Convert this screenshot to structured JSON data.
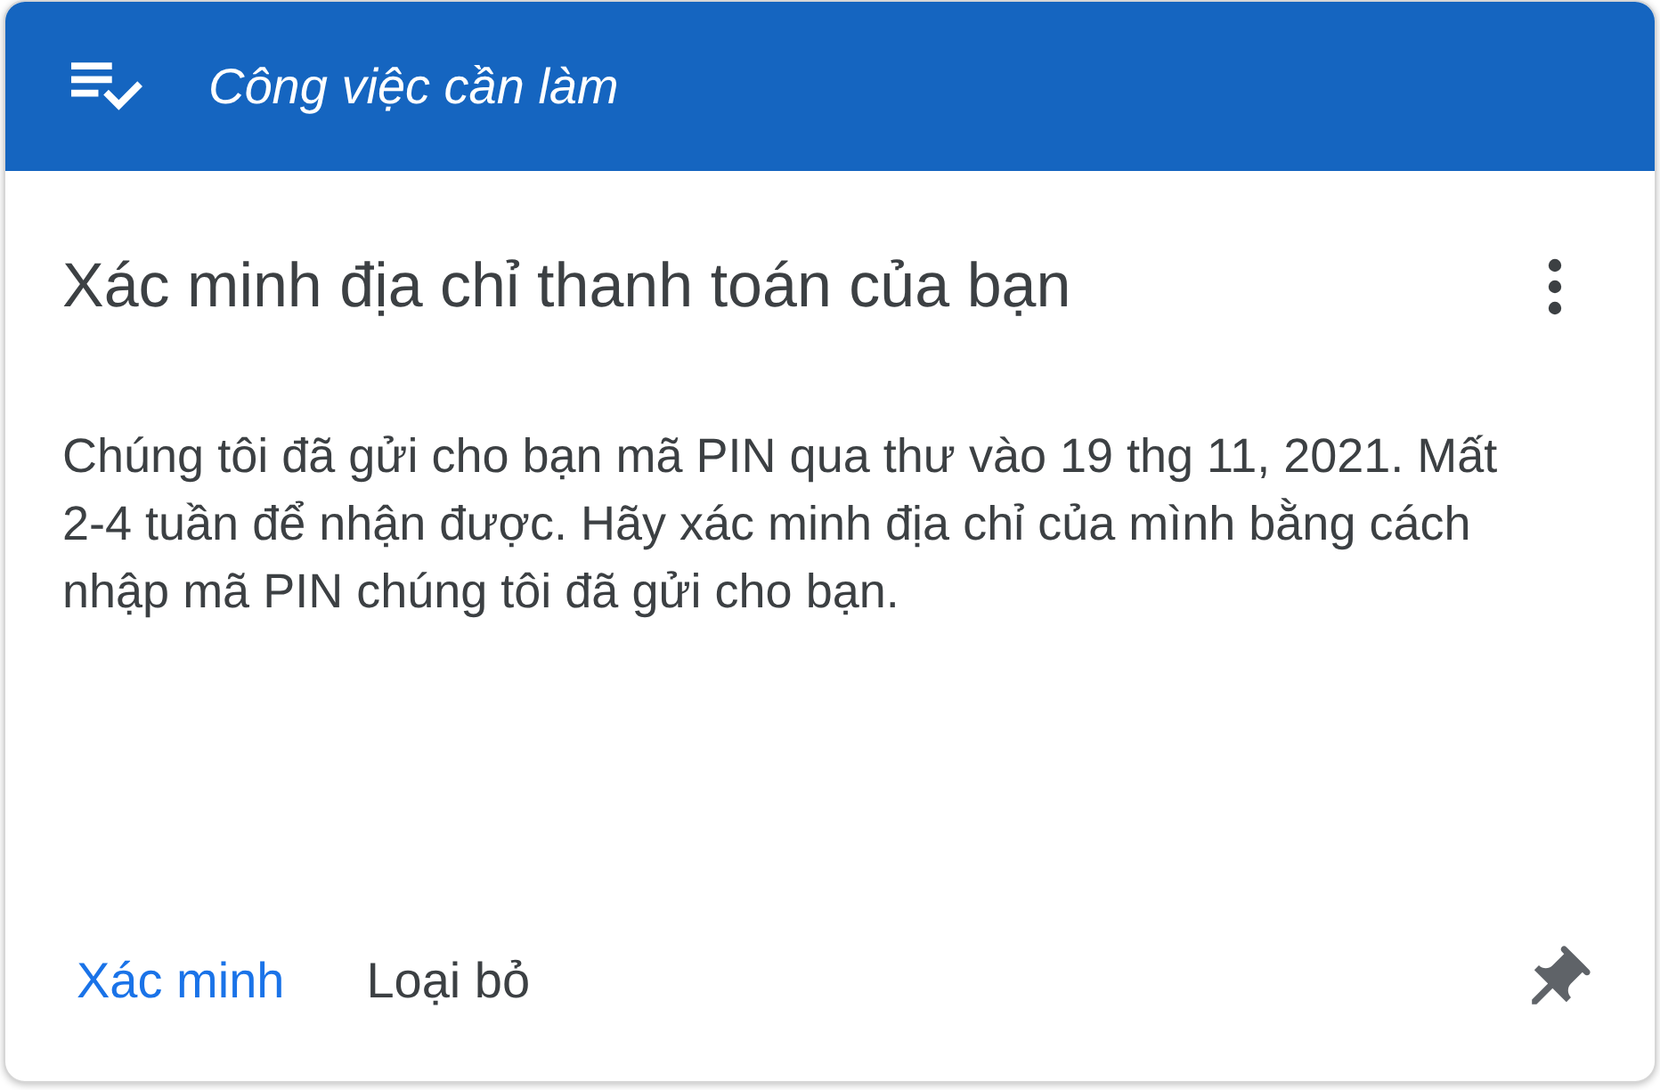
{
  "header": {
    "title": "Công việc cần làm"
  },
  "task": {
    "title": "Xác minh địa chỉ thanh toán của bạn",
    "description": "Chúng tôi đã gửi cho bạn mã PIN qua thư vào 19 thg 11, 2021. Mất 2-4 tuần để nhận được. Hãy xác minh địa chỉ của mình bằng cách nhập mã PIN chúng tôi đã gửi cho bạn."
  },
  "actions": [
    {
      "label": "Xác minh",
      "kind": "primary"
    },
    {
      "label": "Loại bỏ",
      "kind": "secondary"
    }
  ]
}
